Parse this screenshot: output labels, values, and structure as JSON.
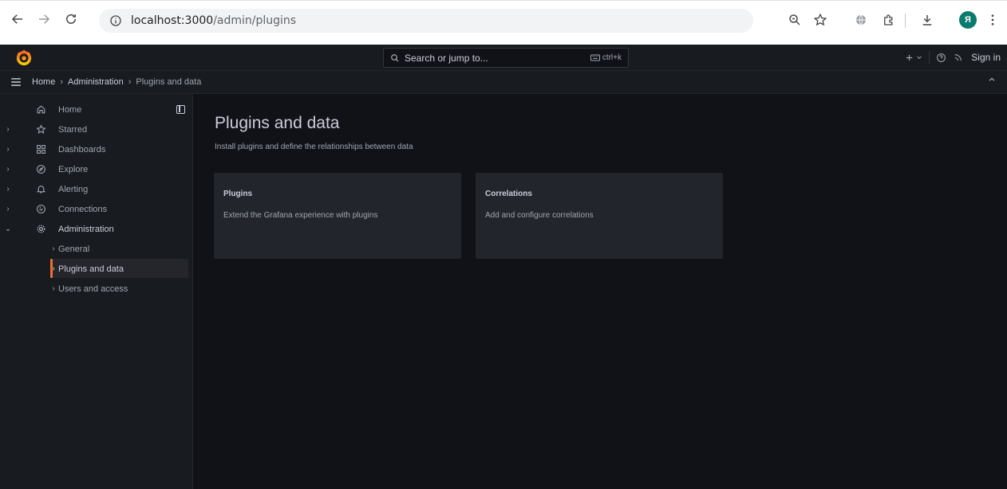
{
  "browser": {
    "url_host": "localhost:3000",
    "url_path": "/admin/plugins",
    "profile_initial": "Я"
  },
  "topbar": {
    "search_placeholder": "Search or jump to...",
    "search_shortcut": "ctrl+k",
    "sign_in": "Sign in"
  },
  "breadcrumbs": [
    "Home",
    "Administration",
    "Plugins and data"
  ],
  "sidebar": {
    "items": [
      {
        "label": "Home",
        "icon": "home-icon"
      },
      {
        "label": "Starred",
        "icon": "star-icon"
      },
      {
        "label": "Dashboards",
        "icon": "apps-icon"
      },
      {
        "label": "Explore",
        "icon": "compass-icon"
      },
      {
        "label": "Alerting",
        "icon": "bell-icon"
      },
      {
        "label": "Connections",
        "icon": "connections-icon"
      },
      {
        "label": "Administration",
        "icon": "cog-icon"
      },
      {
        "label": "General"
      },
      {
        "label": "Plugins and data"
      },
      {
        "label": "Users and access"
      }
    ]
  },
  "main": {
    "title": "Plugins and data",
    "subtitle": "Install plugins and define the relationships between data",
    "cards": [
      {
        "title": "Plugins",
        "description": "Extend the Grafana experience with plugins"
      },
      {
        "title": "Correlations",
        "description": "Add and configure correlations"
      }
    ]
  },
  "colors": {
    "accent": "#f46b2f",
    "background": "#111217",
    "panel": "#181b1f",
    "card": "#22252b"
  }
}
